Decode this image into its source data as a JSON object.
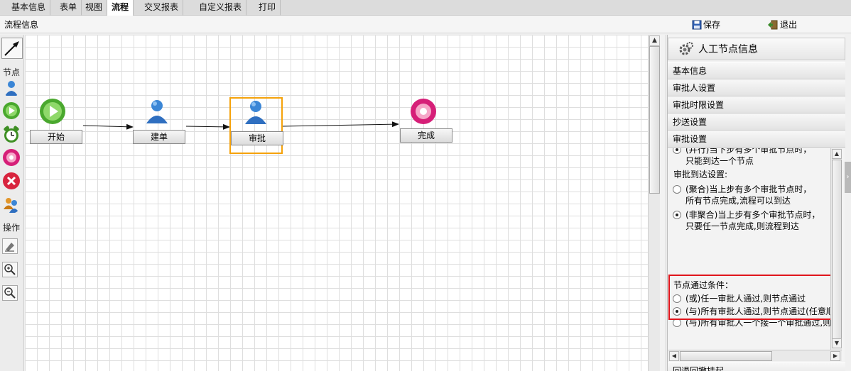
{
  "tabs": [
    {
      "label": "基本信息",
      "active": false
    },
    {
      "label": "表单",
      "active": false
    },
    {
      "label": "视图",
      "active": false
    },
    {
      "label": "流程",
      "active": true
    },
    {
      "label": "交叉报表",
      "active": false
    },
    {
      "label": "自定义报表",
      "active": false
    },
    {
      "label": "打印",
      "active": false
    }
  ],
  "toolbar": {
    "title": "流程信息",
    "save_label": "保存",
    "exit_label": "退出"
  },
  "palette": {
    "nodes_label": "节点",
    "ops_label": "操作"
  },
  "flow": {
    "nodes": [
      {
        "label": "开始",
        "icon": "start-play-icon"
      },
      {
        "label": "建单",
        "icon": "user-icon"
      },
      {
        "label": "审批",
        "icon": "user-icon",
        "selected": true
      },
      {
        "label": "完成",
        "icon": "end-disc-icon"
      }
    ]
  },
  "panel": {
    "title": "人工节点信息",
    "sections": [
      "基本信息",
      "审批人设置",
      "审批时限设置",
      "抄送设置",
      "审批设置"
    ],
    "cut_option": {
      "line1": "(并行)当下步有多个审批节点时，",
      "line2": "只能到达一个节点"
    },
    "arrival_label": "审批到达设置:",
    "arrival_options": [
      {
        "line1": "(聚合)当上步有多个审批节点时，",
        "line2": "所有节点完成,流程可以到达",
        "checked": false
      },
      {
        "line1": "(非聚合)当上步有多个审批节点时，",
        "line2": "只要任一节点完成,则流程到达",
        "checked": true
      }
    ],
    "pass_label": "节点通过条件：",
    "pass_options": [
      {
        "text": "(或)任一审批人通过,则节点通过",
        "checked": false
      },
      {
        "text": "(与)所有审批人通过,则节点通过(任意顺",
        "checked": true
      },
      {
        "text": "(与)所有审批人一个接一个审批通过,则",
        "checked": false
      }
    ],
    "bottom_section": "回退回撤挂起"
  },
  "colors": {
    "selection": "#f5a20a",
    "highlight_box": "#e0141b"
  }
}
